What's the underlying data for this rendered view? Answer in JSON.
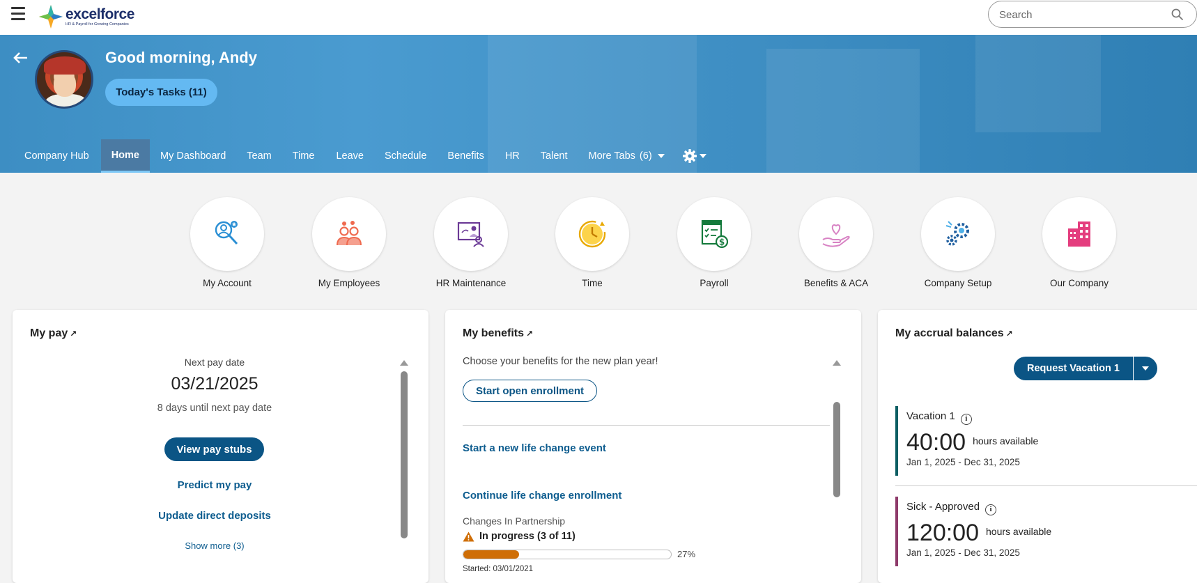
{
  "brand": {
    "name": "excelforce",
    "tagline": "HR & Payroll for Growing Companies"
  },
  "search": {
    "placeholder": "Search"
  },
  "hero": {
    "greeting": "Good morning, Andy",
    "tasks_button": "Today's Tasks (11)"
  },
  "tabs": [
    {
      "label": "Company Hub"
    },
    {
      "label": "Home",
      "active": true
    },
    {
      "label": "My Dashboard"
    },
    {
      "label": "Team"
    },
    {
      "label": "Time"
    },
    {
      "label": "Leave"
    },
    {
      "label": "Schedule"
    },
    {
      "label": "Benefits"
    },
    {
      "label": "HR"
    },
    {
      "label": "Talent"
    },
    {
      "label": "More Tabs",
      "count": "(6)"
    }
  ],
  "quick_links": [
    {
      "label": "My Account",
      "icon": "account-search-icon"
    },
    {
      "label": "My Employees",
      "icon": "employees-icon"
    },
    {
      "label": "HR Maintenance",
      "icon": "hr-maintenance-icon"
    },
    {
      "label": "Time",
      "icon": "clock-icon"
    },
    {
      "label": "Payroll",
      "icon": "payroll-icon"
    },
    {
      "label": "Benefits & ACA",
      "icon": "heart-hand-icon"
    },
    {
      "label": "Company Setup",
      "icon": "gears-icon"
    },
    {
      "label": "Our Company",
      "icon": "building-icon"
    }
  ],
  "my_pay": {
    "title": "My pay",
    "next_pay_label": "Next pay date",
    "next_pay_date": "03/21/2025",
    "days_until": "8 days until next pay date",
    "view_stubs": "View pay stubs",
    "predict": "Predict my pay",
    "update_deposits": "Update direct deposits",
    "show_more": "Show more (3)"
  },
  "my_benefits": {
    "title": "My benefits",
    "intro": "Choose your benefits for the new plan year!",
    "start_enrollment": "Start open enrollment",
    "life_change": "Start a new life change event",
    "continue_life_change": "Continue life change enrollment",
    "event_name": "Changes In Partnership",
    "status": "In progress (3 of 11)",
    "progress": 27,
    "progress_label": "27%",
    "started": "Started: 03/01/2021"
  },
  "accruals": {
    "title": "My accrual balances",
    "request_button": "Request Vacation 1",
    "items": [
      {
        "name": "Vacation 1",
        "value": "40:00",
        "unit": "hours available",
        "range": "Jan 1, 2025 - Dec 31, 2025",
        "color": "#0b5e63"
      },
      {
        "name": "Sick - Approved",
        "value": "120:00",
        "unit": "hours available",
        "range": "Jan 1, 2025 - Dec 31, 2025",
        "color": "#8e3a6a"
      }
    ]
  },
  "colors": {
    "primary": "#0b5585",
    "hero": "#4a9bd0",
    "tasks": "#64b9f2",
    "progress": "#cf6e06"
  }
}
